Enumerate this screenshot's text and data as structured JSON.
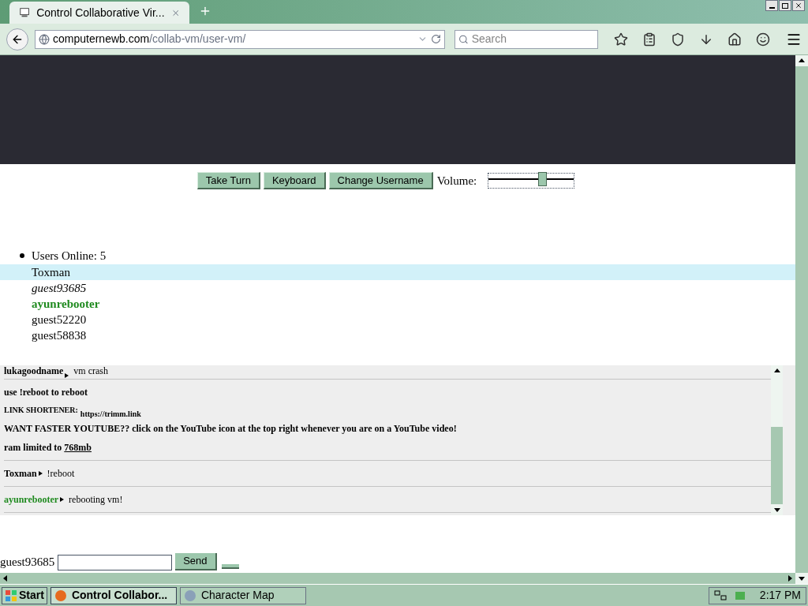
{
  "browser": {
    "tab_title": "Control Collaborative Vir...",
    "url_host": "computernewb.com",
    "url_path": "/collab-vm/user-vm/",
    "search_placeholder": "Search"
  },
  "controls": {
    "buttons": [
      "Take Turn",
      "Keyboard",
      "Change Username"
    ],
    "volume_label": "Volume:",
    "volume": {
      "level": 0.63
    }
  },
  "users": {
    "header": "Users Online: 5",
    "list": [
      {
        "name": "Toxman",
        "kind": "normal",
        "selected": true
      },
      {
        "name": "guest93685",
        "kind": "self",
        "selected": false
      },
      {
        "name": "ayunrebooter",
        "kind": "admin",
        "selected": false
      },
      {
        "name": "guest52220",
        "kind": "normal",
        "selected": false
      },
      {
        "name": "guest58838",
        "kind": "normal",
        "selected": false
      }
    ]
  },
  "chat": [
    {
      "kind": "message",
      "user": "lukagoodname",
      "admin": false,
      "text": "vm crash"
    },
    {
      "kind": "notice",
      "lines": [
        {
          "kind": "plain",
          "text": "use !reboot to reboot"
        },
        {
          "kind": "small",
          "label": "LINK SHORTENER:",
          "text": "https://trimm.link"
        },
        {
          "kind": "plain",
          "text": "WANT FASTER YOUTUBE?? click on the YouTube icon at the top right whenever you are on a YouTube video!"
        },
        {
          "kind": "link",
          "text": "ram limited to ",
          "link": "768mb"
        }
      ]
    },
    {
      "kind": "message",
      "user": "Toxman",
      "admin": false,
      "text": "!reboot"
    },
    {
      "kind": "message",
      "user": "ayunrebooter",
      "admin": true,
      "text": "rebooting vm!"
    }
  ],
  "input": {
    "username": "guest93685",
    "send": "Send"
  },
  "taskbar": {
    "start": "Start",
    "tasks": [
      {
        "label": "Control Collabor...",
        "selected": true
      },
      {
        "label": "Character Map",
        "selected": false
      }
    ],
    "clock": "2:17 PM"
  }
}
